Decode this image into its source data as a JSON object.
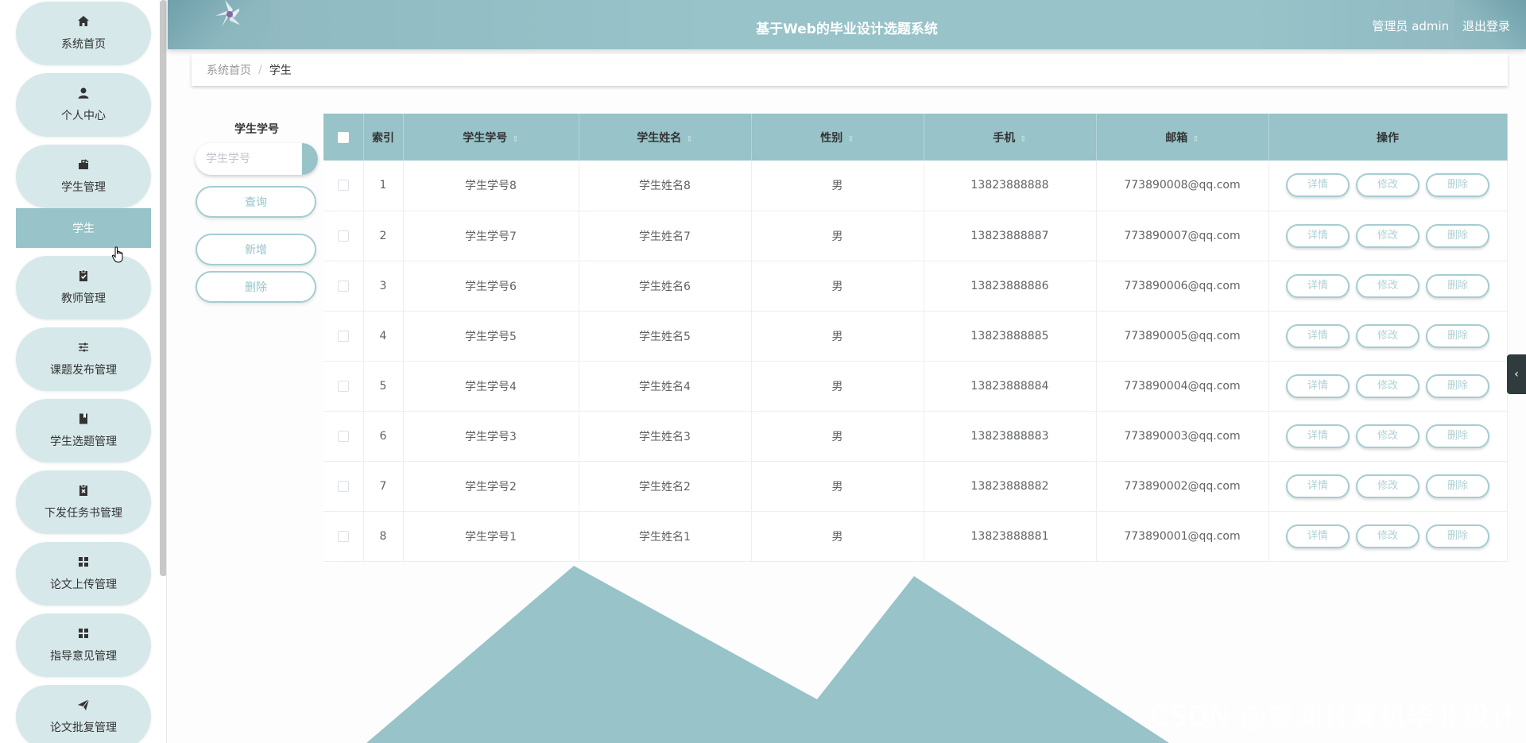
{
  "app": {
    "title": "基于Web的毕业设计选题系统",
    "user_label": "管理员 admin",
    "logout": "退出登录"
  },
  "sidebar": {
    "items": [
      {
        "label": "系统首页",
        "icon": "home-icon"
      },
      {
        "label": "个人中心",
        "icon": "user-icon"
      },
      {
        "label": "学生管理",
        "icon": "briefcase-icon"
      },
      {
        "label": "教师管理",
        "icon": "clipboard-check-icon"
      },
      {
        "label": "课题发布管理",
        "icon": "sliders-icon"
      },
      {
        "label": "学生选题管理",
        "icon": "book-icon"
      },
      {
        "label": "下发任务书管理",
        "icon": "clipboard-x-icon"
      },
      {
        "label": "论文上传管理",
        "icon": "grid-icon"
      },
      {
        "label": "指导意见管理",
        "icon": "grid-icon"
      },
      {
        "label": "论文批复管理",
        "icon": "send-icon"
      }
    ],
    "sub_item": "学生"
  },
  "breadcrumb": {
    "home": "系统首页",
    "separator": "/",
    "current": "学生"
  },
  "search": {
    "label": "学生学号",
    "placeholder": "学生学号",
    "query_button": "查询",
    "add_button": "新增",
    "delete_button": "删除"
  },
  "table": {
    "columns": [
      "索引",
      "学生学号",
      "学生姓名",
      "性别",
      "手机",
      "邮箱",
      "操作"
    ],
    "rows": [
      {
        "index": "1",
        "student_no": "学生学号8",
        "name": "学生姓名8",
        "gender": "男",
        "phone": "13823888888",
        "email": "773890008@qq.com"
      },
      {
        "index": "2",
        "student_no": "学生学号7",
        "name": "学生姓名7",
        "gender": "男",
        "phone": "13823888887",
        "email": "773890007@qq.com"
      },
      {
        "index": "3",
        "student_no": "学生学号6",
        "name": "学生姓名6",
        "gender": "男",
        "phone": "13823888886",
        "email": "773890006@qq.com"
      },
      {
        "index": "4",
        "student_no": "学生学号5",
        "name": "学生姓名5",
        "gender": "男",
        "phone": "13823888885",
        "email": "773890005@qq.com"
      },
      {
        "index": "5",
        "student_no": "学生学号4",
        "name": "学生姓名4",
        "gender": "男",
        "phone": "13823888884",
        "email": "773890004@qq.com"
      },
      {
        "index": "6",
        "student_no": "学生学号3",
        "name": "学生姓名3",
        "gender": "男",
        "phone": "13823888883",
        "email": "773890003@qq.com"
      },
      {
        "index": "7",
        "student_no": "学生学号2",
        "name": "学生姓名2",
        "gender": "男",
        "phone": "13823888882",
        "email": "773890002@qq.com"
      },
      {
        "index": "8",
        "student_no": "学生学号1",
        "name": "学生姓名1",
        "gender": "男",
        "phone": "13823888881",
        "email": "773890001@qq.com"
      }
    ],
    "actions": {
      "detail": "详情",
      "edit": "修改",
      "delete": "删除"
    }
  },
  "watermark": "CSDN @睿渊计算机毕业设计",
  "colors": {
    "accent": "#97c3c9",
    "menu_bg": "#d6e8ea"
  }
}
